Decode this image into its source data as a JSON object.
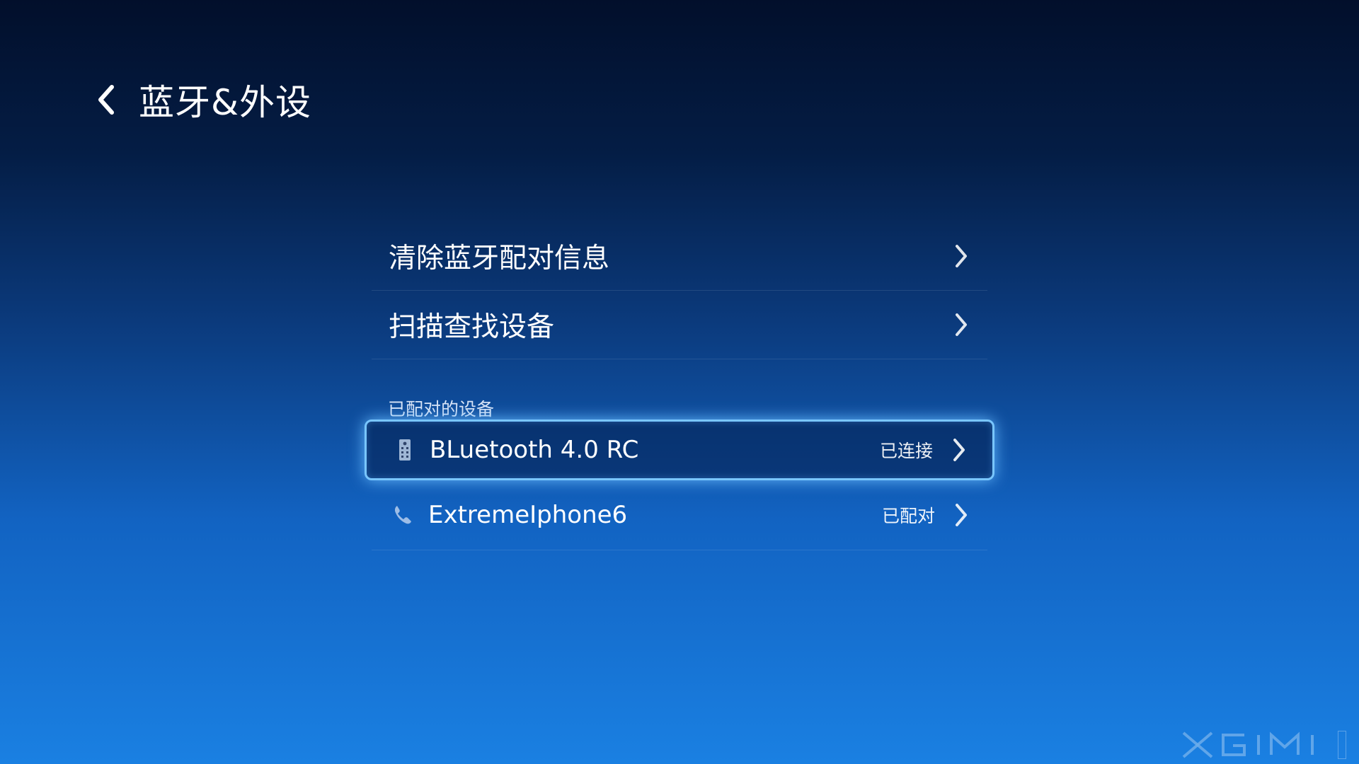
{
  "header": {
    "back_icon": "chevron-left-icon",
    "title": "蓝牙&外设"
  },
  "menu": {
    "items": [
      {
        "label": "清除蓝牙配对信息",
        "icon": "chevron-right-icon"
      },
      {
        "label": "扫描查找设备",
        "icon": "chevron-right-icon"
      }
    ]
  },
  "paired_section": {
    "label": "已配对的设备",
    "devices": [
      {
        "icon": "remote-control-icon",
        "name": "BLuetooth 4.0 RC",
        "status": "已连接",
        "focused": true
      },
      {
        "icon": "phone-icon",
        "name": "ExtremeIphone6",
        "status": "已配对",
        "focused": false
      }
    ]
  },
  "branding": {
    "logo": "XGIMI"
  },
  "colors": {
    "focus_border": "#79c6ff",
    "background_top": "#020f2b",
    "background_bottom": "#1a80e2"
  }
}
